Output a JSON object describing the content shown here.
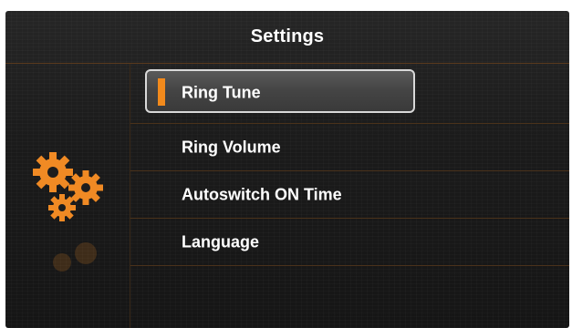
{
  "header": {
    "title": "Settings"
  },
  "menu": {
    "items": [
      {
        "label": "Ring Tune",
        "selected": true
      },
      {
        "label": "Ring Volume",
        "selected": false
      },
      {
        "label": "Autoswitch ON Time",
        "selected": false
      },
      {
        "label": "Language",
        "selected": false
      }
    ]
  },
  "sidebar": {
    "icon": "gears-icon"
  },
  "colors": {
    "accent": "#f28a1c",
    "background": "#1c1c1c",
    "divider": "#4a321b",
    "text": "#ffffff",
    "selection_border": "#d9d9d9"
  }
}
